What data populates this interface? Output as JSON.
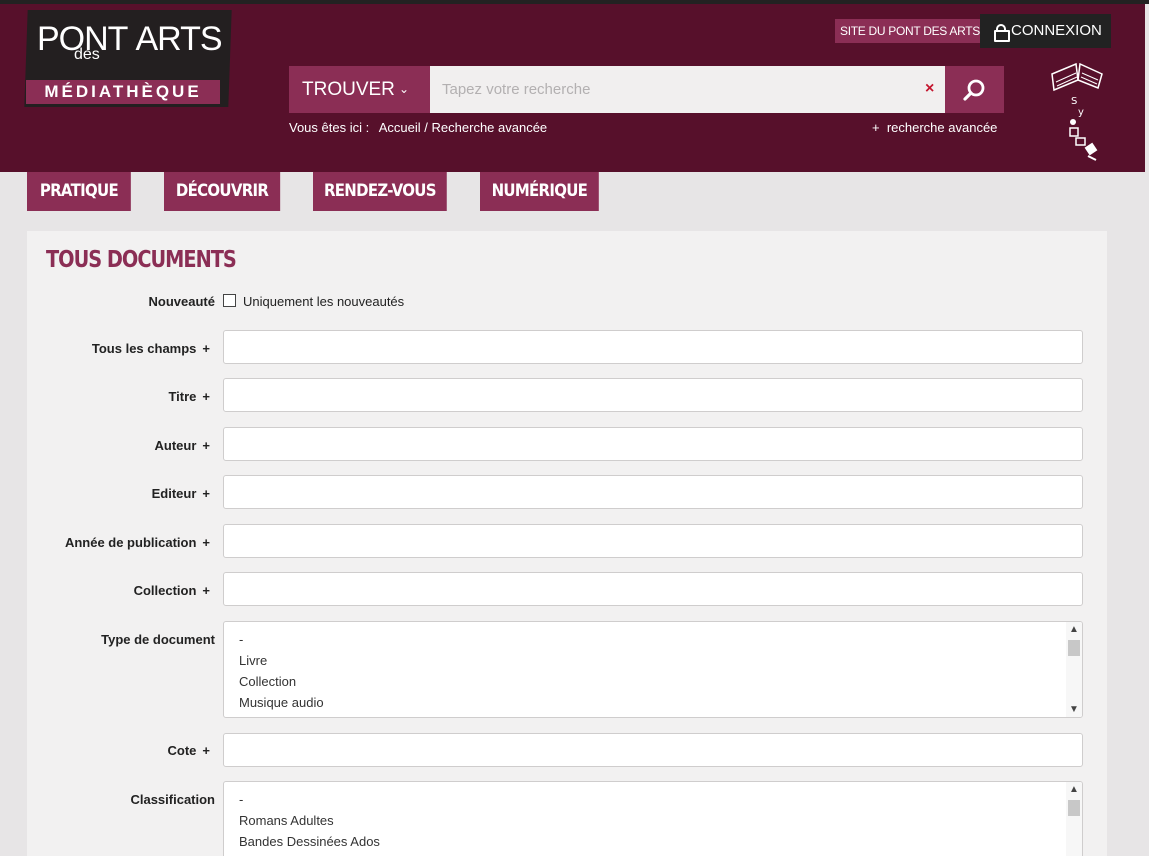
{
  "logo": {
    "main": "PONTDESARTS",
    "line1": "PONT",
    "line2": "ARTS",
    "sub": "des",
    "badge": "MÉDIATHÈQUE"
  },
  "header": {
    "site_link": "SITE DU PONT DES ARTS",
    "connexion": "CONNEXION",
    "trouver": "TROUVER",
    "search_placeholder": "Tapez votre recherche",
    "clear": "×",
    "breadcrumb_prefix": "Vous êtes ici :",
    "breadcrumb_home": "Accueil",
    "breadcrumb_current": "Recherche avancée",
    "advanced_link": "recherche avancée"
  },
  "nav": [
    "PRATIQUE",
    "DÉCOUVRIR",
    "RENDEZ-VOUS",
    "NUMÉRIQUE"
  ],
  "form": {
    "title": "TOUS DOCUMENTS",
    "nouveaute_label": "Nouveauté",
    "nouveaute_checkbox": "Uniquement les nouveautés",
    "fields": [
      "Tous les champs",
      "Titre",
      "Auteur",
      "Editeur",
      "Année de publication",
      "Collection"
    ],
    "type_label": "Type de document",
    "type_options": [
      "-",
      "Livre",
      "Collection",
      "Musique audio"
    ],
    "cote_label": "Cote",
    "classification_label": "Classification",
    "classification_options": [
      "-",
      "Romans Adultes",
      "Bandes Dessinées Ados"
    ]
  },
  "colors": {
    "header": "#57102b",
    "accent": "#8b2e55",
    "dark": "#231f20"
  }
}
